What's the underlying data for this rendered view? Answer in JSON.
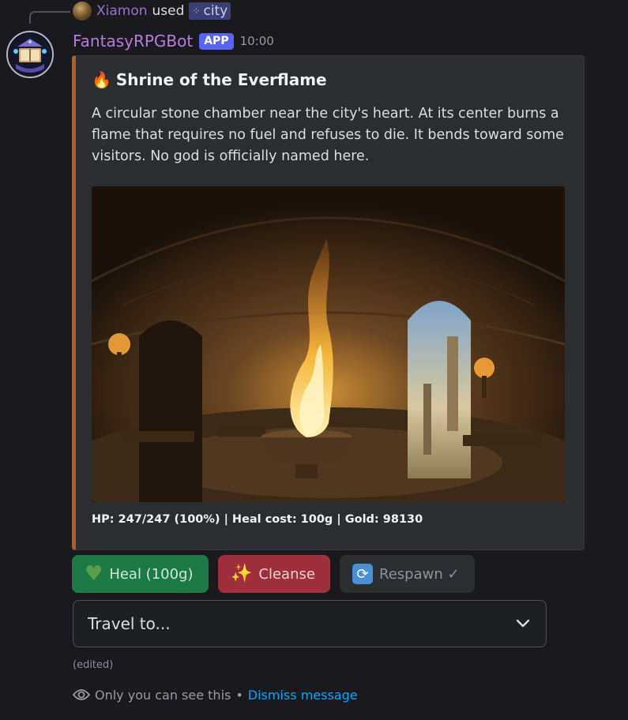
{
  "reply": {
    "username": "Xiamon",
    "action": "used",
    "command": "city",
    "command_icon": "slash-command-icon",
    "avatar_icon": "user-avatar"
  },
  "message": {
    "bot_name": "FantasyRPGBot",
    "badge": "APP",
    "timestamp": "10:00",
    "avatar_icon": "bot-avatar-book"
  },
  "embed": {
    "accent_color": "#b35f1b",
    "title_icon": "fire-icon",
    "title": "Shrine of the Everflame",
    "description": "A circular stone chamber near the city's heart. At its center burns a flame that requires no fuel and refuses to die. It bends toward some visitors. No god is officially named here.",
    "image_icon": "shrine-flame-image",
    "footer": "HP: 247/247 (100%) | Heal cost: 100g | Gold: 98130"
  },
  "buttons": [
    {
      "label": "Heal (100g)",
      "icon": "green-heart-icon",
      "color": "#1d7a46"
    },
    {
      "label": "Cleanse",
      "icon": "sparkles-icon",
      "color": "#9f2f3c"
    },
    {
      "label": "Respawn ✓",
      "icon": "respawn-arrows-icon",
      "color": "#2b2d31"
    }
  ],
  "select": {
    "placeholder": "Travel to..."
  },
  "edited_label": "(edited)",
  "ephemeral": {
    "notice": "Only you can see this",
    "separator": "•",
    "dismiss_label": "Dismiss message"
  }
}
